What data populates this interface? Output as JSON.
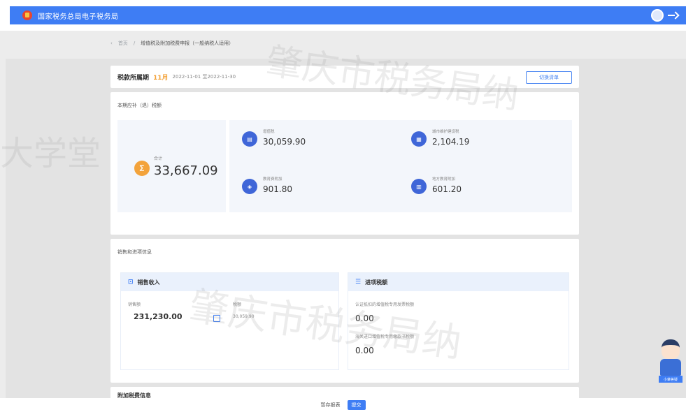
{
  "header": {
    "site_title": "国家税务总局电子税务局"
  },
  "breadcrumb": {
    "items": [
      "首页",
      "增值税及附加税费申报（一般纳税人适用）"
    ]
  },
  "period": {
    "label": "税款所属期",
    "month": "11月",
    "range": "2022-11-01 至2022-11-30",
    "button_label": "切换清单"
  },
  "tax": {
    "title": "本期应补（退）税额",
    "total_label": "合计",
    "total_value": "33,667.09",
    "items": [
      {
        "label": "增值税",
        "value": "30,059.90",
        "icon": "invoice-icon"
      },
      {
        "label": "城市维护建设税",
        "value": "2,104.19",
        "icon": "building-icon"
      },
      {
        "label": "教育费附加",
        "value": "901.80",
        "icon": "education-icon"
      },
      {
        "label": "地方教育附加",
        "value": "601.20",
        "icon": "grid-icon"
      }
    ]
  },
  "sales": {
    "title": "销售和进项信息",
    "income": {
      "title": "销售收入",
      "sales_label": "销售额",
      "sales_value": "231,230.00",
      "tax_label": "税额",
      "tax_value": "30,059.90"
    },
    "input": {
      "title": "进项税额",
      "row1_label": "认证抵扣的增值税专用发票税额",
      "row1_value": "0.00",
      "row2_label": "海关进口增值税专用缴款书税额",
      "row2_value": "0.00"
    }
  },
  "next_section": {
    "title": "附加税费信息"
  },
  "footer": {
    "secondary_label": "暂存报表",
    "primary_label": "提交"
  },
  "watermark": {
    "left": "大学堂",
    "center_top": "肇庆市税务局纳",
    "center_bottom": "肇庆市税务局纳"
  },
  "robot": {
    "badge": "小肇答疑"
  }
}
